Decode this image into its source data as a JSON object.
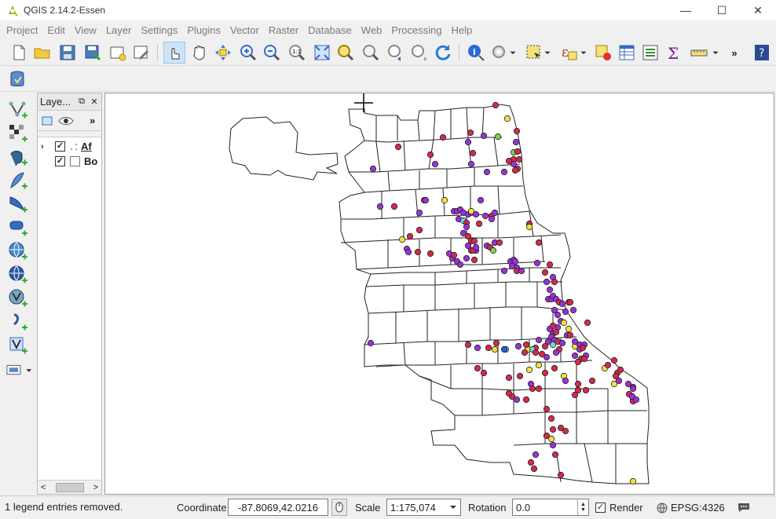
{
  "window": {
    "title": "QGIS 2.14.2-Essen",
    "minimize_glyph": "—",
    "maximize_glyph": "☐",
    "close_glyph": "✕"
  },
  "menu": [
    "Project",
    "Edit",
    "View",
    "Layer",
    "Settings",
    "Plugins",
    "Vector",
    "Raster",
    "Database",
    "Web",
    "Processing",
    "Help"
  ],
  "layers_panel": {
    "title": "Laye...",
    "float_glyph": "⧉",
    "close_glyph": "✕",
    "more_glyph": "»",
    "layers": [
      {
        "name": "Af",
        "checked": true,
        "expanded": false
      },
      {
        "name": "Bo",
        "checked": true,
        "expanded": false
      }
    ],
    "scroll_left": "<",
    "scroll_right": ">"
  },
  "toolbar_overflow": "»",
  "status": {
    "message": "1 legend entries removed.",
    "coordinate_label": "Coordinate",
    "coordinate_value": "-87.8069,42.0216",
    "scale_label": "Scale",
    "scale_value": "1:175,074",
    "rotation_label": "Rotation",
    "rotation_value": "0.0",
    "render_label": "Render",
    "render_checked": true,
    "crs": "EPSG:4326"
  },
  "map": {
    "point_colors": {
      "purple": "#9b30d9",
      "red": "#d42a4a",
      "yellow": "#f2e13a",
      "green": "#7ecf4a",
      "cyan": "#6fd6d6",
      "blue": "#2a5bd9"
    }
  }
}
